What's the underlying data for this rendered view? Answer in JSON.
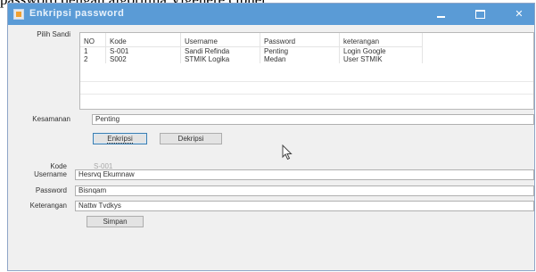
{
  "caption": "password dengan algoritma Vigenere cipher.",
  "window": {
    "title": "Enkripsi password",
    "minimize_label": "—",
    "close_label": "✕"
  },
  "labels": {
    "pilih_sandi": "Pilih Sandi",
    "kunci": "Kesamanan",
    "kode": "Kode",
    "username": "Username",
    "password": "Password",
    "keterangan": "Keterangan"
  },
  "table": {
    "columns": [
      "NO",
      "Kode",
      "Username",
      "Password",
      "keterangan"
    ],
    "rows": [
      [
        "1",
        "S-001",
        "Sandi Refinda",
        "Penting",
        "Login Google"
      ],
      [
        "2",
        "S002",
        "STMIK Logika",
        "Medan",
        "User STMIK"
      ]
    ]
  },
  "form": {
    "kunci_value": "Penting",
    "kode_value": "S-001",
    "username_value": "Hesrvq Ekumnaw",
    "password_value": "Bisnqam",
    "keterangan_value": "Nattw Tvdkys"
  },
  "buttons": {
    "enkripsi": "Enkripsi",
    "dekripsi": "Dekripsi",
    "simpan": "Simpan"
  },
  "icons": {
    "app": "app-window-icon",
    "minimize": "minimize-icon",
    "maximize": "maximize-icon",
    "close": "close-icon",
    "cursor": "mouse-pointer-icon"
  },
  "colors": {
    "titlebar": "#5a9bd6",
    "window_bg": "#f0f0f0",
    "focus_border": "#3c7fb1"
  }
}
